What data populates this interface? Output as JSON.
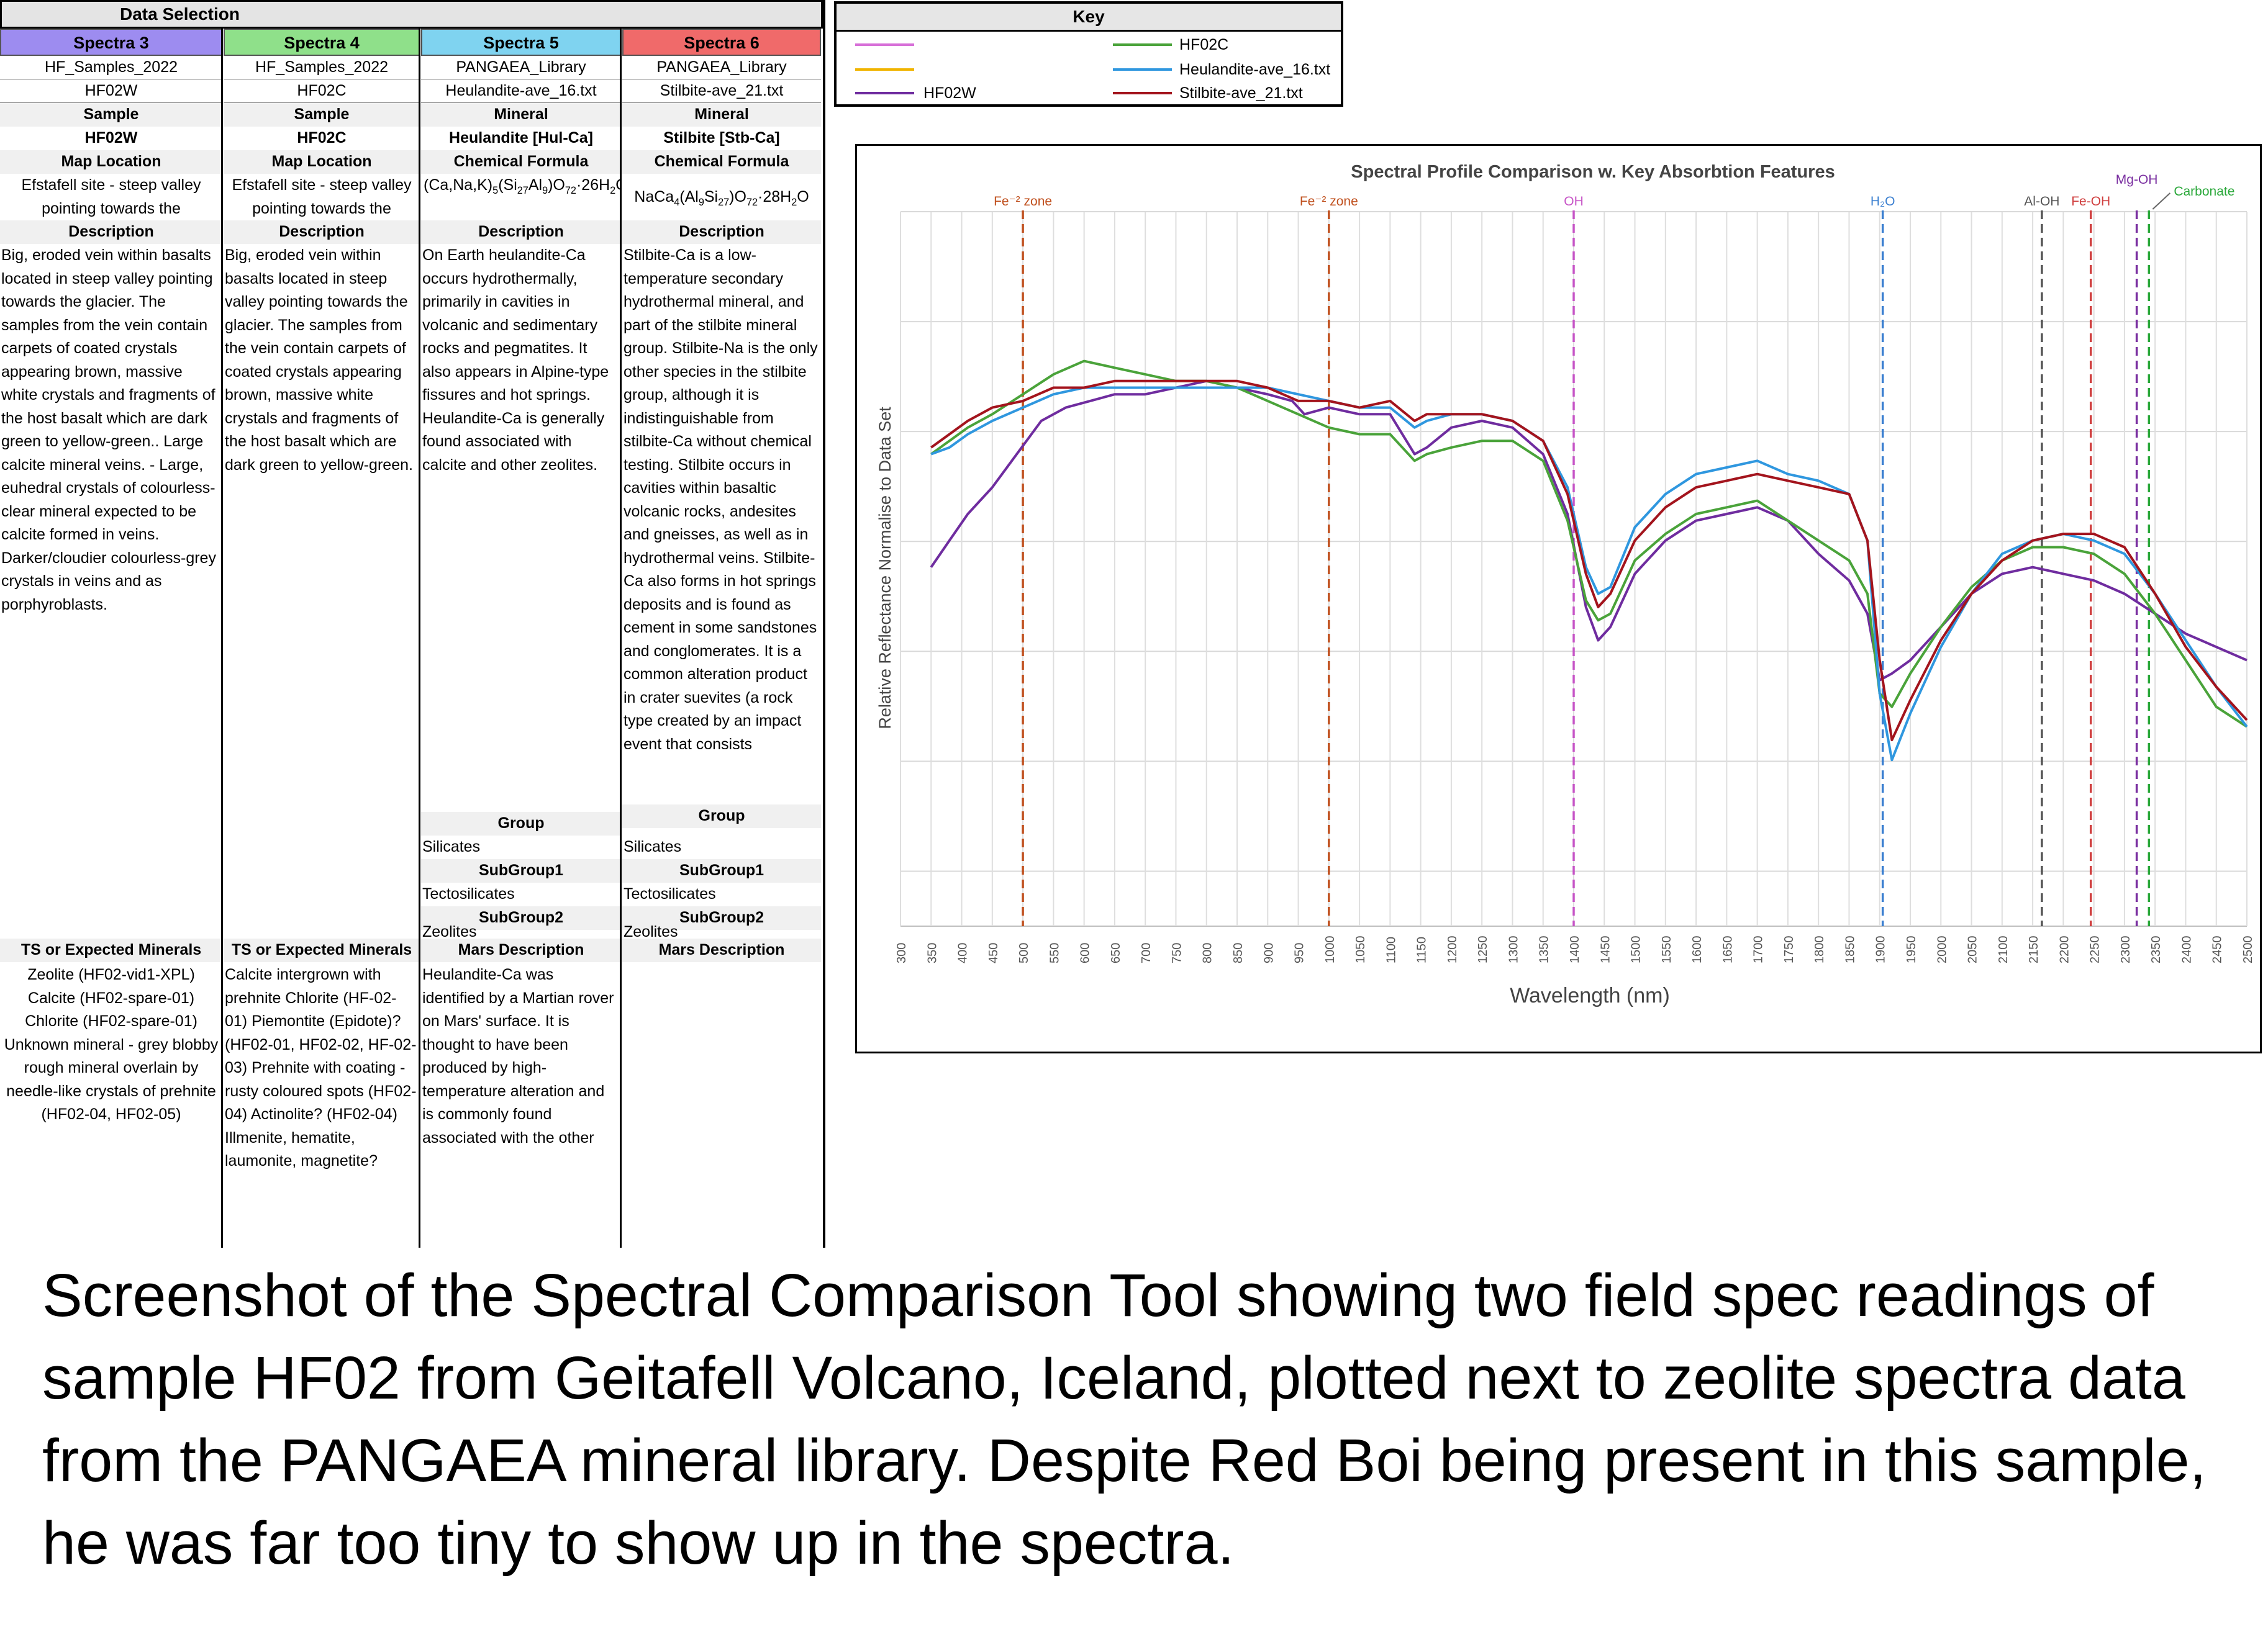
{
  "data_selection": {
    "title": "Data Selection",
    "columns": [
      {
        "header": "Spectra 3",
        "header_color": "#9d8cf0",
        "source": "HF_Samples_2022",
        "file": "HF02W",
        "type_label": "Sample",
        "name": "HF02W",
        "location_label": "Map Location",
        "location": "Efstafell site - steep valley pointing towards the",
        "description_label": "Description",
        "description": "Big, eroded vein within basalts located in steep valley pointing towards the glacier. The samples from the vein contain carpets of coated crystals appearing brown, massive white crystals and fragments of the host basalt which are dark green to yellow-green.. Large calcite mineral veins. - Large, euhedral crystals of colourless-clear mineral expected to be calcite formed in veins. Darker/cloudier colourless-grey crystals in veins and as porphyroblasts.",
        "ts_label": "TS or Expected Minerals",
        "ts": "Zeolite (HF02-vid1-XPL) Calcite (HF02-spare-01) Chlorite (HF02-spare-01) Unknown mineral - grey blobby rough mineral overlain by needle-like crystals of prehnite (HF02-04, HF02-05)"
      },
      {
        "header": "Spectra 4",
        "header_color": "#8fe08a",
        "source": "HF_Samples_2022",
        "file": "HF02C",
        "type_label": "Sample",
        "name": "HF02C",
        "location_label": "Map Location",
        "location": "Efstafell site - steep valley pointing towards the",
        "description_label": "Description",
        "description": "Big, eroded vein within basalts located in steep valley pointing towards the glacier. The samples from the vein contain carpets of coated crystals appearing brown, massive white crystals and fragments of the host basalt which are dark green to yellow-green.",
        "ts_label": "TS or Expected Minerals",
        "ts": "Calcite intergrown with prehnite Chlorite (HF-02-01) Piemontite (Epidote)? (HF02-01, HF02-02, HF-02-03) Prehnite with coating - rusty coloured spots (HF02-04) Actinolite? (HF02-04) Illmenite, hematite, laumonite, magnetite?"
      },
      {
        "header": "Spectra 5",
        "header_color": "#7fd3f0",
        "source": "PANGAEA_Library",
        "file": "Heulandite-ave_16.txt",
        "type_label": "Mineral",
        "name": "Heulandite [Hul-Ca]",
        "formula_label": "Chemical Formula",
        "formula_html": "(Ca,Na,K)<sub>5</sub>(Si<sub>27</sub>Al<sub>9</sub>)O<sub>72</sub>·26H<sub>2</sub>O",
        "description_label": "Description",
        "description": "On Earth heulandite-Ca occurs hydrothermally, primarily in cavities in volcanic and sedimentary rocks and pegmatites. It also appears in Alpine-type fissures and hot springs. Heulandite-Ca is generally found associated with calcite and other zeolites.",
        "group_label": "Group",
        "group": "Silicates",
        "subgroup1_label": "SubGroup1",
        "subgroup1": "Tectosilicates",
        "subgroup2_label": "SubGroup2",
        "subgroup2": "Zeolites",
        "mars_label": "Mars Description",
        "mars": "Heulandite-Ca was identified by a Martian rover on Mars' surface. It is thought to have been produced by high-temperature alteration and is commonly found associated with the other zeolites and quartz."
      },
      {
        "header": "Spectra 6",
        "header_color": "#f06a6a",
        "source": "PANGAEA_Library",
        "file": "Stilbite-ave_21.txt",
        "type_label": "Mineral",
        "name": "Stilbite [Stb-Ca]",
        "formula_label": "Chemical Formula",
        "formula_html": "NaCa<sub>4</sub>(Al<sub>9</sub>Si<sub>27</sub>)O<sub>72</sub>·28H<sub>2</sub>O",
        "description_label": "Description",
        "description": "Stilbite-Ca is a low-temperature secondary hydrothermal mineral, and part of the stilbite mineral group. Stilbite-Na is the only other species in the stilbite group, although it is indistinguishable from stilbite-Ca without chemical testing. Stilbite occurs in cavities within basaltic volcanic rocks, andesites and gneisses, as well as in hydrothermal veins. Stilbite-Ca also forms in hot springs deposits and is found as cement in some sandstones and conglomerates. It is a common alteration product in crater suevites (a rock type created by an impact event that consists",
        "group_label": "Group",
        "group": "Silicates",
        "subgroup1_label": "SubGroup1",
        "subgroup1": "Tectosilicates",
        "subgroup2_label": "SubGroup2",
        "subgroup2": "Zeolites",
        "mars_label": "Mars Description",
        "mars": ""
      }
    ]
  },
  "key": {
    "title": "Key",
    "entries": [
      {
        "label": "",
        "color": "#d76fd8"
      },
      {
        "label": "HF02C",
        "color": "#4aa33a"
      },
      {
        "label": "",
        "color": "#f0b400"
      },
      {
        "label": "Heulandite-ave_16.txt",
        "color": "#2f97df"
      },
      {
        "label": "HF02W",
        "color": "#6f2c9f"
      },
      {
        "label": "Stilbite-ave_21.txt",
        "color": "#a3141d"
      }
    ]
  },
  "chart_data": {
    "type": "line",
    "title": "Spectral Profile Comparison w. Key Absorbtion Features",
    "xlabel": "Wavelength (nm)",
    "ylabel": "Relative Reflectance Normalise to Data Set",
    "xlim": [
      300,
      2500
    ],
    "ylim": [
      0,
      1
    ],
    "x_ticks": [
      300,
      350,
      400,
      450,
      500,
      550,
      600,
      650,
      700,
      750,
      800,
      850,
      900,
      950,
      1000,
      1050,
      1100,
      1150,
      1200,
      1250,
      1300,
      1350,
      1400,
      1450,
      1500,
      1550,
      1600,
      1650,
      1700,
      1750,
      1800,
      1850,
      1900,
      1950,
      2000,
      2050,
      2100,
      2150,
      2200,
      2250,
      2300,
      2350,
      2400,
      2450,
      2500
    ],
    "grid": true,
    "annotations": [
      {
        "label": "Fe⁻² zone",
        "x": 500,
        "color": "#c0501e"
      },
      {
        "label": "Fe⁻² zone",
        "x": 1000,
        "color": "#c0501e"
      },
      {
        "label": "OH",
        "x": 1400,
        "color": "#c653c6"
      },
      {
        "label": "H₂O",
        "x": 1905,
        "color": "#3a7fd0"
      },
      {
        "label": "Al-OH",
        "x": 2165,
        "color": "#555555"
      },
      {
        "label": "Fe-OH",
        "x": 2245,
        "color": "#d04040"
      },
      {
        "label": "Mg-OH",
        "x": 2320,
        "color": "#7a2fa0"
      },
      {
        "label": "Carbonate",
        "x": 2340,
        "color": "#2aa83a"
      }
    ],
    "series": [
      {
        "name": "HF02W",
        "color": "#6f2c9f",
        "x": [
          350,
          380,
          410,
          450,
          490,
          530,
          570,
          610,
          650,
          700,
          750,
          800,
          850,
          900,
          940,
          960,
          1000,
          1050,
          1100,
          1140,
          1160,
          1200,
          1250,
          1300,
          1350,
          1390,
          1420,
          1440,
          1460,
          1500,
          1550,
          1600,
          1650,
          1700,
          1750,
          1800,
          1850,
          1880,
          1900,
          1920,
          1950,
          2000,
          2050,
          2100,
          2150,
          2200,
          2250,
          2300,
          2350,
          2400,
          2450,
          2500
        ],
        "y": [
          0.54,
          0.58,
          0.62,
          0.66,
          0.71,
          0.76,
          0.78,
          0.79,
          0.8,
          0.8,
          0.81,
          0.82,
          0.81,
          0.8,
          0.79,
          0.77,
          0.78,
          0.77,
          0.77,
          0.71,
          0.72,
          0.75,
          0.76,
          0.75,
          0.71,
          0.62,
          0.48,
          0.43,
          0.45,
          0.53,
          0.58,
          0.61,
          0.62,
          0.63,
          0.61,
          0.56,
          0.52,
          0.47,
          0.37,
          0.38,
          0.4,
          0.45,
          0.5,
          0.53,
          0.54,
          0.53,
          0.52,
          0.5,
          0.47,
          0.44,
          0.42,
          0.4
        ]
      },
      {
        "name": "HF02C",
        "color": "#4aa33a",
        "x": [
          350,
          380,
          410,
          450,
          500,
          550,
          600,
          650,
          700,
          750,
          800,
          850,
          900,
          950,
          1000,
          1050,
          1100,
          1140,
          1160,
          1200,
          1250,
          1300,
          1350,
          1390,
          1420,
          1440,
          1460,
          1500,
          1550,
          1600,
          1650,
          1700,
          1750,
          1800,
          1850,
          1880,
          1900,
          1920,
          1950,
          2000,
          2050,
          2100,
          2150,
          2200,
          2250,
          2300,
          2350,
          2400,
          2450,
          2500
        ],
        "y": [
          0.71,
          0.73,
          0.75,
          0.77,
          0.8,
          0.83,
          0.85,
          0.84,
          0.83,
          0.82,
          0.82,
          0.81,
          0.79,
          0.77,
          0.75,
          0.74,
          0.74,
          0.7,
          0.71,
          0.72,
          0.73,
          0.73,
          0.7,
          0.61,
          0.49,
          0.46,
          0.47,
          0.55,
          0.59,
          0.62,
          0.63,
          0.64,
          0.61,
          0.58,
          0.55,
          0.5,
          0.35,
          0.33,
          0.38,
          0.45,
          0.51,
          0.55,
          0.57,
          0.57,
          0.56,
          0.53,
          0.47,
          0.4,
          0.33,
          0.3
        ]
      },
      {
        "name": "Heulandite-ave_16.txt",
        "color": "#2f97df",
        "x": [
          350,
          380,
          410,
          450,
          500,
          550,
          600,
          650,
          700,
          750,
          800,
          850,
          900,
          950,
          1000,
          1050,
          1100,
          1140,
          1160,
          1200,
          1250,
          1300,
          1350,
          1390,
          1420,
          1440,
          1460,
          1500,
          1550,
          1600,
          1650,
          1700,
          1750,
          1800,
          1850,
          1880,
          1900,
          1920,
          1950,
          2000,
          2050,
          2100,
          2150,
          2200,
          2250,
          2300,
          2350,
          2400,
          2450,
          2500
        ],
        "y": [
          0.71,
          0.72,
          0.74,
          0.76,
          0.78,
          0.8,
          0.81,
          0.81,
          0.81,
          0.81,
          0.81,
          0.81,
          0.81,
          0.8,
          0.79,
          0.78,
          0.78,
          0.75,
          0.76,
          0.77,
          0.77,
          0.76,
          0.73,
          0.66,
          0.54,
          0.5,
          0.51,
          0.6,
          0.65,
          0.68,
          0.69,
          0.7,
          0.68,
          0.67,
          0.65,
          0.58,
          0.35,
          0.25,
          0.32,
          0.42,
          0.5,
          0.56,
          0.58,
          0.59,
          0.58,
          0.56,
          0.5,
          0.43,
          0.36,
          0.3
        ]
      },
      {
        "name": "Stilbite-ave_21.txt",
        "color": "#a3141d",
        "x": [
          350,
          380,
          410,
          450,
          500,
          550,
          600,
          650,
          700,
          750,
          800,
          850,
          900,
          950,
          1000,
          1050,
          1100,
          1140,
          1160,
          1200,
          1250,
          1300,
          1350,
          1390,
          1420,
          1440,
          1460,
          1500,
          1550,
          1600,
          1650,
          1700,
          1750,
          1800,
          1850,
          1880,
          1900,
          1920,
          1950,
          2000,
          2050,
          2100,
          2150,
          2200,
          2250,
          2300,
          2350,
          2400,
          2450,
          2500
        ],
        "y": [
          0.72,
          0.74,
          0.76,
          0.78,
          0.79,
          0.81,
          0.81,
          0.82,
          0.82,
          0.82,
          0.82,
          0.82,
          0.81,
          0.79,
          0.79,
          0.78,
          0.79,
          0.76,
          0.77,
          0.77,
          0.77,
          0.76,
          0.73,
          0.65,
          0.53,
          0.48,
          0.5,
          0.58,
          0.63,
          0.66,
          0.67,
          0.68,
          0.67,
          0.66,
          0.65,
          0.58,
          0.4,
          0.28,
          0.34,
          0.43,
          0.5,
          0.55,
          0.58,
          0.59,
          0.59,
          0.57,
          0.5,
          0.42,
          0.36,
          0.31
        ]
      }
    ]
  },
  "caption": "Screenshot of the Spectral Comparison Tool showing two field spec readings of sample HF02 from Geitafell Volcano, Iceland, plotted next to zeolite spectra data from the PANGAEA mineral library. Despite Red Boi being present in this sample, he was far too tiny to show up in the spectra."
}
